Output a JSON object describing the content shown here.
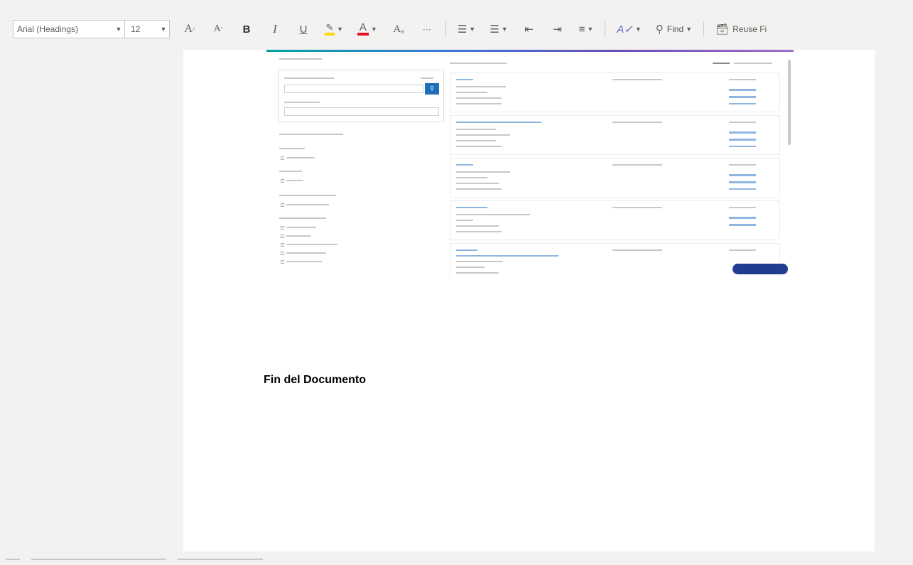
{
  "toolbar": {
    "font_name": "Arial (Headings)",
    "font_size": "12",
    "find_label": "Find",
    "reuse_label": "Reuse Fi"
  },
  "document": {
    "end_text": "Fin del Documento"
  },
  "colors": {
    "highlight": "#ffd700",
    "font_color": "#e81123",
    "accent_blue": "#1e3d8f"
  },
  "icons": [
    "grow-font-icon",
    "shrink-font-icon",
    "bold-icon",
    "italic-icon",
    "underline-icon",
    "highlight-icon",
    "font-color-icon",
    "styles-icon",
    "more-icon",
    "bullets-icon",
    "numbering-icon",
    "decrease-indent-icon",
    "increase-indent-icon",
    "align-icon",
    "editor-icon",
    "search-icon",
    "reuse-files-icon"
  ]
}
